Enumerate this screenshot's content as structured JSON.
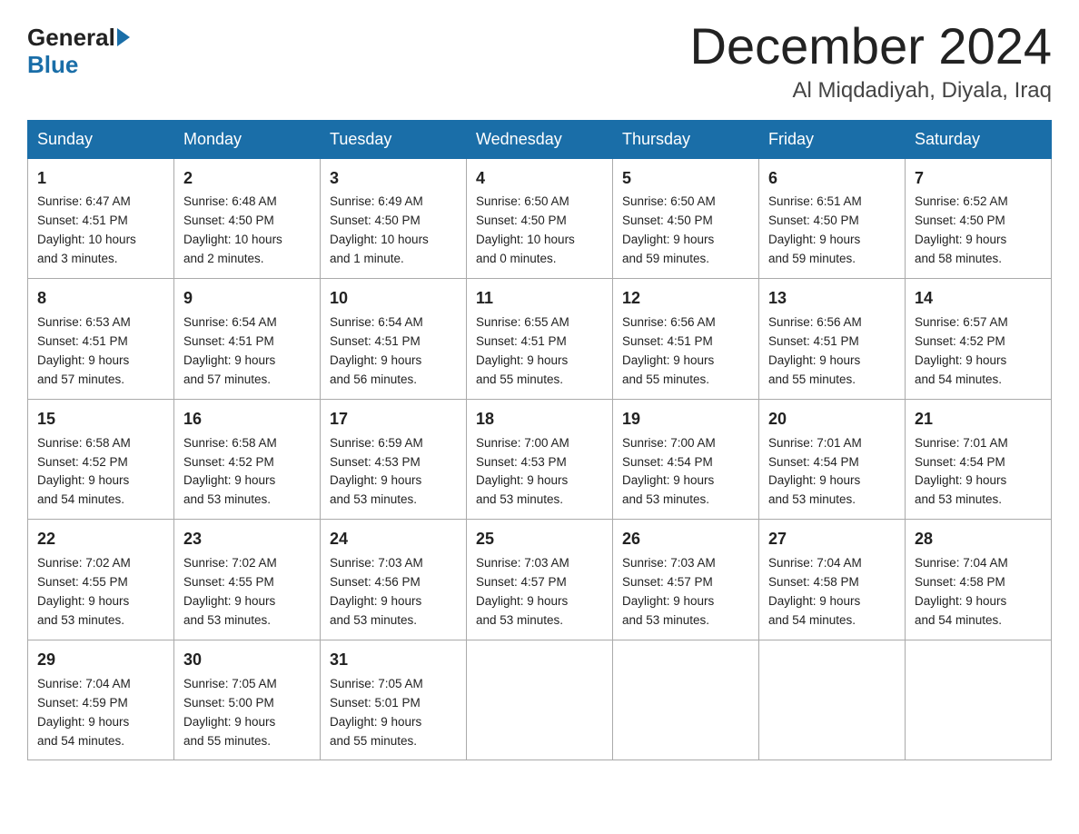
{
  "logo": {
    "general": "General",
    "blue": "Blue"
  },
  "header": {
    "month": "December 2024",
    "location": "Al Miqdadiyah, Diyala, Iraq"
  },
  "days_of_week": [
    "Sunday",
    "Monday",
    "Tuesday",
    "Wednesday",
    "Thursday",
    "Friday",
    "Saturday"
  ],
  "weeks": [
    [
      {
        "day": "1",
        "sunrise": "6:47 AM",
        "sunset": "4:51 PM",
        "daylight": "10 hours and 3 minutes."
      },
      {
        "day": "2",
        "sunrise": "6:48 AM",
        "sunset": "4:50 PM",
        "daylight": "10 hours and 2 minutes."
      },
      {
        "day": "3",
        "sunrise": "6:49 AM",
        "sunset": "4:50 PM",
        "daylight": "10 hours and 1 minute."
      },
      {
        "day": "4",
        "sunrise": "6:50 AM",
        "sunset": "4:50 PM",
        "daylight": "10 hours and 0 minutes."
      },
      {
        "day": "5",
        "sunrise": "6:50 AM",
        "sunset": "4:50 PM",
        "daylight": "9 hours and 59 minutes."
      },
      {
        "day": "6",
        "sunrise": "6:51 AM",
        "sunset": "4:50 PM",
        "daylight": "9 hours and 59 minutes."
      },
      {
        "day": "7",
        "sunrise": "6:52 AM",
        "sunset": "4:50 PM",
        "daylight": "9 hours and 58 minutes."
      }
    ],
    [
      {
        "day": "8",
        "sunrise": "6:53 AM",
        "sunset": "4:51 PM",
        "daylight": "9 hours and 57 minutes."
      },
      {
        "day": "9",
        "sunrise": "6:54 AM",
        "sunset": "4:51 PM",
        "daylight": "9 hours and 57 minutes."
      },
      {
        "day": "10",
        "sunrise": "6:54 AM",
        "sunset": "4:51 PM",
        "daylight": "9 hours and 56 minutes."
      },
      {
        "day": "11",
        "sunrise": "6:55 AM",
        "sunset": "4:51 PM",
        "daylight": "9 hours and 55 minutes."
      },
      {
        "day": "12",
        "sunrise": "6:56 AM",
        "sunset": "4:51 PM",
        "daylight": "9 hours and 55 minutes."
      },
      {
        "day": "13",
        "sunrise": "6:56 AM",
        "sunset": "4:51 PM",
        "daylight": "9 hours and 55 minutes."
      },
      {
        "day": "14",
        "sunrise": "6:57 AM",
        "sunset": "4:52 PM",
        "daylight": "9 hours and 54 minutes."
      }
    ],
    [
      {
        "day": "15",
        "sunrise": "6:58 AM",
        "sunset": "4:52 PM",
        "daylight": "9 hours and 54 minutes."
      },
      {
        "day": "16",
        "sunrise": "6:58 AM",
        "sunset": "4:52 PM",
        "daylight": "9 hours and 53 minutes."
      },
      {
        "day": "17",
        "sunrise": "6:59 AM",
        "sunset": "4:53 PM",
        "daylight": "9 hours and 53 minutes."
      },
      {
        "day": "18",
        "sunrise": "7:00 AM",
        "sunset": "4:53 PM",
        "daylight": "9 hours and 53 minutes."
      },
      {
        "day": "19",
        "sunrise": "7:00 AM",
        "sunset": "4:54 PM",
        "daylight": "9 hours and 53 minutes."
      },
      {
        "day": "20",
        "sunrise": "7:01 AM",
        "sunset": "4:54 PM",
        "daylight": "9 hours and 53 minutes."
      },
      {
        "day": "21",
        "sunrise": "7:01 AM",
        "sunset": "4:54 PM",
        "daylight": "9 hours and 53 minutes."
      }
    ],
    [
      {
        "day": "22",
        "sunrise": "7:02 AM",
        "sunset": "4:55 PM",
        "daylight": "9 hours and 53 minutes."
      },
      {
        "day": "23",
        "sunrise": "7:02 AM",
        "sunset": "4:55 PM",
        "daylight": "9 hours and 53 minutes."
      },
      {
        "day": "24",
        "sunrise": "7:03 AM",
        "sunset": "4:56 PM",
        "daylight": "9 hours and 53 minutes."
      },
      {
        "day": "25",
        "sunrise": "7:03 AM",
        "sunset": "4:57 PM",
        "daylight": "9 hours and 53 minutes."
      },
      {
        "day": "26",
        "sunrise": "7:03 AM",
        "sunset": "4:57 PM",
        "daylight": "9 hours and 53 minutes."
      },
      {
        "day": "27",
        "sunrise": "7:04 AM",
        "sunset": "4:58 PM",
        "daylight": "9 hours and 54 minutes."
      },
      {
        "day": "28",
        "sunrise": "7:04 AM",
        "sunset": "4:58 PM",
        "daylight": "9 hours and 54 minutes."
      }
    ],
    [
      {
        "day": "29",
        "sunrise": "7:04 AM",
        "sunset": "4:59 PM",
        "daylight": "9 hours and 54 minutes."
      },
      {
        "day": "30",
        "sunrise": "7:05 AM",
        "sunset": "5:00 PM",
        "daylight": "9 hours and 55 minutes."
      },
      {
        "day": "31",
        "sunrise": "7:05 AM",
        "sunset": "5:01 PM",
        "daylight": "9 hours and 55 minutes."
      },
      null,
      null,
      null,
      null
    ]
  ],
  "labels": {
    "sunrise": "Sunrise:",
    "sunset": "Sunset:",
    "daylight": "Daylight:"
  }
}
